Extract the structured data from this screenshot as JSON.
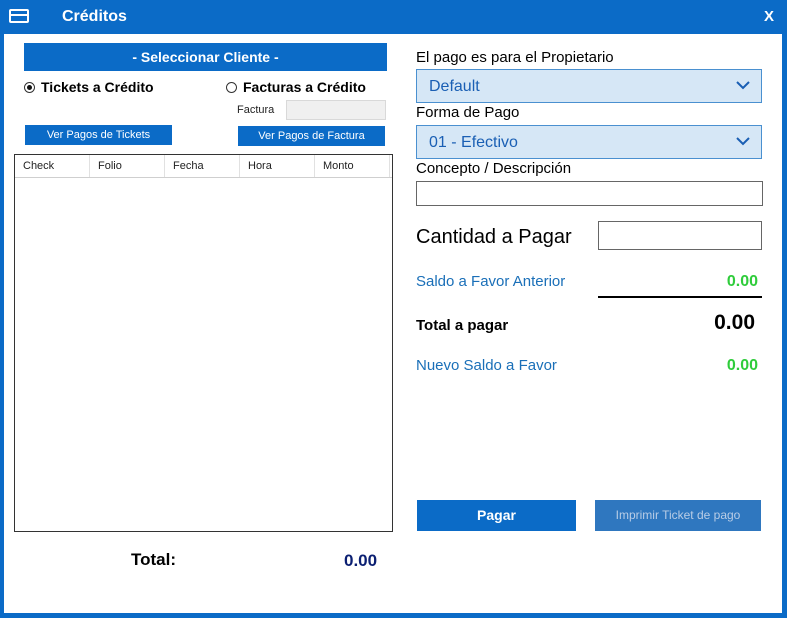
{
  "window": {
    "title": "Créditos",
    "close_label": "X"
  },
  "left": {
    "select_client_label": "- Seleccionar Cliente -",
    "radio_tickets_label": "Tickets a Crédito",
    "radio_facturas_label": "Facturas a Crédito",
    "selected_radio": "tickets",
    "factura_label": "Factura",
    "factura_value": "",
    "ver_pagos_tickets_label": "Ver Pagos de Tickets",
    "ver_pagos_factura_label": "Ver Pagos de Factura",
    "grid_columns": [
      "Check",
      "Folio",
      "Fecha",
      "Hora",
      "Monto"
    ],
    "grid_rows": [],
    "total_label": "Total:",
    "total_value": "0.00"
  },
  "right": {
    "propietario_label": "El pago es para el Propietario",
    "propietario_value": "Default",
    "forma_pago_label": "Forma de Pago",
    "forma_pago_value": "01 - Efectivo",
    "concepto_label": "Concepto / Descripción",
    "concepto_value": "",
    "cantidad_label": "Cantidad a Pagar",
    "cantidad_value": "",
    "saldo_anterior_label": "Saldo a Favor Anterior",
    "saldo_anterior_value": "0.00",
    "total_pagar_label": "Total a pagar",
    "total_pagar_value": "0.00",
    "nuevo_saldo_label": "Nuevo Saldo a Favor",
    "nuevo_saldo_value": "0.00",
    "pagar_label": "Pagar",
    "imprimir_label": "Imprimir Ticket de pago"
  },
  "colors": {
    "accent": "#0b6bc7",
    "green": "#2fcc3b",
    "link": "#1a6fb8",
    "total": "#0b1f72"
  }
}
